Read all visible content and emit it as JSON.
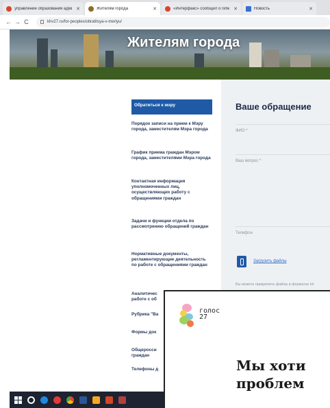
{
  "browser": {
    "tabs": [
      {
        "label": "управление образования админ",
        "favicon_color": "#d9442b",
        "active": false
      },
      {
        "label": "Жителям города",
        "favicon_color": "#8b6b2a",
        "active": true
      },
      {
        "label": "«Интерфакс» сообщил о гибели",
        "favicon_color": "#d9442b",
        "active": false
      },
      {
        "label": "Новость",
        "favicon_color": "#3a6fd0",
        "active": false
      }
    ],
    "url": "khv27.ru/for-peoples/obratitsya-v-meriyu/"
  },
  "hero": {
    "title": "Жителям города"
  },
  "sidebar": {
    "items": [
      {
        "label": "Обратиться к мэру"
      },
      {
        "label": "Порядок записи на прием к Мэру города, заместителям Мэра города"
      },
      {
        "label": "График приема граждан Мэром города, заместителями Мэра города"
      },
      {
        "label": "Контактная информация уполномоченных лиц, осуществляющих работу с обращениями граждан"
      },
      {
        "label": "Задачи и функции отдела по рассмотрению обращений граждан"
      },
      {
        "label": "Нормативные документы, регламентирующие деятельность по работе с обращениями граждан"
      },
      {
        "label": "Аналитичес"
      },
      {
        "label": "Рубрика \"Ва"
      },
      {
        "label": "Формы док"
      },
      {
        "label": "Общеросси"
      },
      {
        "label": "Телефоны д"
      }
    ],
    "extra_line": "работе с об",
    "extra_line2": "граждан"
  },
  "form": {
    "title": "Ваше обращение",
    "fio_placeholder": "ФИО *",
    "question_placeholder": "Ваш вопрос *",
    "phone_placeholder": "Телефон",
    "upload_label": "Загрузить файлы",
    "hint": "Вы можете прикрепить файлы в форматах txt"
  },
  "card": {
    "logo_line1": "голос",
    "logo_line2": "27",
    "headline_line1": "Мы хоти",
    "headline_line2": "проблем"
  },
  "taskbar": {
    "icons": [
      "windows-icon",
      "cortana-icon",
      "edge-icon",
      "chrome-icon",
      "yandex-icon",
      "word-icon",
      "explorer-icon",
      "powerpoint-icon",
      "settings-icon"
    ]
  }
}
